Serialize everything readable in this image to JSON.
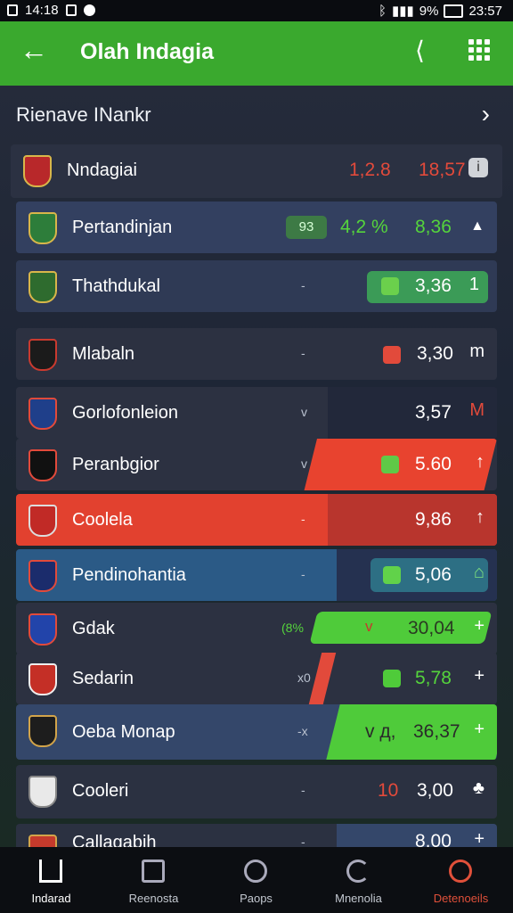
{
  "status_bar": {
    "time": "14:18",
    "battery": "9%",
    "clock_right": "23:57"
  },
  "app_bar": {
    "title": "Olah Indagia",
    "back_icon": "arrow-left-icon",
    "share_icon": "share-icon",
    "menu_icon": "grid-menu-icon"
  },
  "section": {
    "title": "Rienave INankr"
  },
  "rows": [
    {
      "name": "Nndagiai",
      "badge": "",
      "value1": "1,2.8",
      "value2": "18,57",
      "trail": "i",
      "value_color": "#e24a3b"
    },
    {
      "name": "Pertandinjan",
      "badge": "93",
      "value1": "4,2 %",
      "value2": "8,36",
      "trail": "▲",
      "value_color": "#55d43c"
    },
    {
      "name": "Thathdukal",
      "mid": "-",
      "value2": "3,36",
      "trail": "1",
      "value_color": "#ffffff"
    },
    {
      "name": "Mlabaln",
      "mid": "-",
      "value2": "3,30",
      "trail": "m",
      "value_color": "#ffffff"
    },
    {
      "name": "Gorlofonleion",
      "mid": "v",
      "value2": "3,57",
      "trail": "M",
      "value_color": "#ffffff"
    },
    {
      "name": "Peranbgior",
      "mid": "v",
      "value2": "5.60",
      "trail": "↑",
      "value_color": "#ffffff"
    },
    {
      "name": "Coolela",
      "mid": "-",
      "value2": "9,86",
      "trail": "↑",
      "value_color": "#ffffff"
    },
    {
      "name": "Pendinohantia",
      "mid": "-",
      "value2": "5,06",
      "trail": "⌂",
      "value_color": "#ffffff"
    },
    {
      "name": "Gdak",
      "mid": "(8%",
      "value1": "v",
      "value2": "30,04",
      "trail": "+",
      "value_color": "#ffffff"
    },
    {
      "name": "Sedarin",
      "mid": "x0",
      "value2": "5,78",
      "trail": "+",
      "value_color": "#55d43c"
    },
    {
      "name": "Oeba Monap",
      "mid": "-x",
      "value1": "v д,",
      "value2": "36,37",
      "trail": "+",
      "value_color": "#2a2a2a"
    },
    {
      "name": "Cooleri",
      "mid": "-",
      "value1": "10",
      "value2": "3,00",
      "trail": "♣",
      "value_color": "#ffffff"
    },
    {
      "name": "Callagabih",
      "mid": "-",
      "value2": "8,00",
      "trail": "+",
      "value_color": "#ffffff"
    }
  ],
  "bottom_nav": [
    {
      "label": "Indarad",
      "icon": "home-icon",
      "active": true
    },
    {
      "label": "Reenosta",
      "icon": "calendar-icon"
    },
    {
      "label": "Paops",
      "icon": "circle-icon"
    },
    {
      "label": "Mnenolia",
      "icon": "refresh-icon"
    },
    {
      "label": "Detenoeils",
      "icon": "user-badge-icon",
      "accent": "#e0503a"
    }
  ],
  "colors": {
    "accent_green": "#3aa92e",
    "red": "#e24a3b",
    "bright_green": "#55d43c"
  }
}
